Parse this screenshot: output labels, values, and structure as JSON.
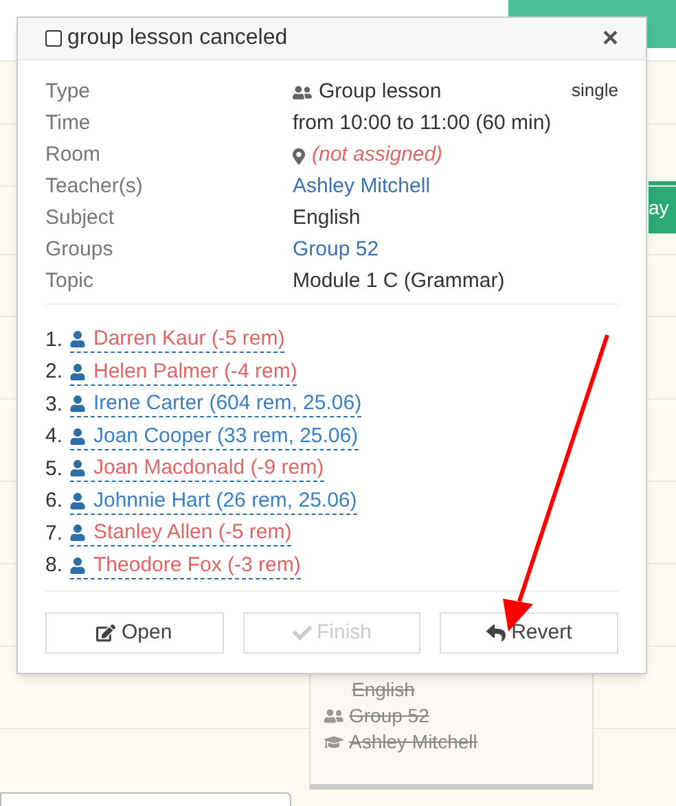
{
  "background": {
    "side_button": "ay",
    "event_card": {
      "lines": [
        {
          "kind": "subject",
          "text": "English"
        },
        {
          "kind": "group",
          "text": "Group 52"
        },
        {
          "kind": "teacher",
          "text": "Ashley Mitchell"
        }
      ],
      "canceled": true
    }
  },
  "popover": {
    "title": "group lesson canceled",
    "checked": false,
    "close": "×",
    "details": [
      {
        "label": "Type",
        "kind": "type",
        "value": "Group lesson",
        "badge": "single"
      },
      {
        "label": "Time",
        "kind": "plain",
        "value": "from 10:00 to 11:00 (60 min)"
      },
      {
        "label": "Room",
        "kind": "room",
        "value": "(not assigned)"
      },
      {
        "label": "Teacher(s)",
        "kind": "link",
        "value": "Ashley Mitchell"
      },
      {
        "label": "Subject",
        "kind": "plain",
        "value": "English"
      },
      {
        "label": "Groups",
        "kind": "link",
        "value": "Group 52"
      },
      {
        "label": "Topic",
        "kind": "plain",
        "value": "Module 1 C (Grammar)"
      }
    ],
    "students": [
      {
        "number": "1.",
        "name": "Darren Kaur (-5 rem)",
        "color": "#e06666"
      },
      {
        "number": "2.",
        "name": "Helen Palmer (-4 rem)",
        "color": "#e06666"
      },
      {
        "number": "3.",
        "name": "Irene Carter (604 rem, 25.06)",
        "color": "#3b7fc4"
      },
      {
        "number": "4.",
        "name": "Joan Cooper (33 rem, 25.06)",
        "color": "#3b7fc4"
      },
      {
        "number": "5.",
        "name": "Joan Macdonald (-9 rem)",
        "color": "#e06666"
      },
      {
        "number": "6.",
        "name": "Johnnie Hart (26 rem, 25.06)",
        "color": "#3b7fc4"
      },
      {
        "number": "7.",
        "name": "Stanley Allen (-5 rem)",
        "color": "#e06666"
      },
      {
        "number": "8.",
        "name": "Theodore Fox (-3 rem)",
        "color": "#e06666"
      }
    ],
    "buttons": [
      {
        "label": "Open",
        "kind": "edit",
        "disabled": false
      },
      {
        "label": "Finish",
        "kind": "check",
        "disabled": true
      },
      {
        "label": "Revert",
        "kind": "undo",
        "disabled": false
      }
    ]
  }
}
